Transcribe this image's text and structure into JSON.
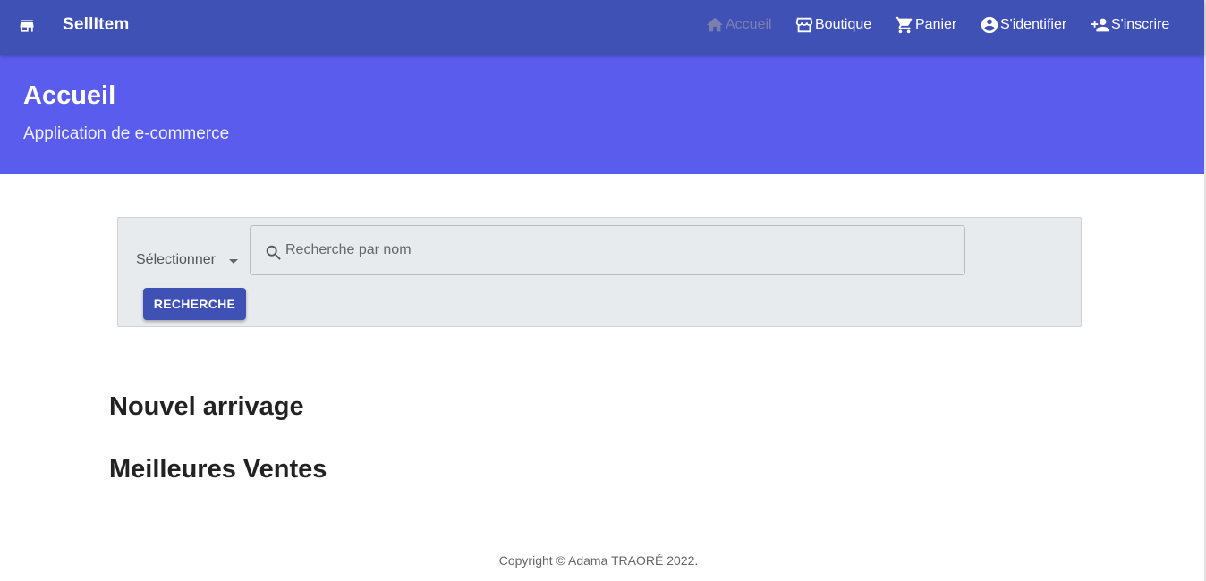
{
  "app": {
    "brand_icon": "store-icon",
    "brand_name": "SellItem"
  },
  "nav": [
    {
      "icon": "home-icon",
      "label": "Accueil",
      "active": true
    },
    {
      "icon": "storefront-icon",
      "label": "Boutique",
      "active": false
    },
    {
      "icon": "shopping-cart-icon",
      "label": "Panier",
      "active": false
    },
    {
      "icon": "account-circle-icon",
      "label": "S'identifier",
      "active": false
    },
    {
      "icon": "person-add-icon",
      "label": "S'inscrire",
      "active": false
    }
  ],
  "hero": {
    "title": "Accueil",
    "subtitle": "Application de e-commerce"
  },
  "search": {
    "select_value": "Sélectionner",
    "input_value": "",
    "input_placeholder": "Recherche par nom",
    "button_label": "RECHERCHE"
  },
  "sections": {
    "new_arrivals": "Nouvel arrivage",
    "best_sellers": "Meilleures Ventes"
  },
  "footer": {
    "copyright": "Copyright © Adama TRAORÉ 2022."
  },
  "colors": {
    "appbar": "#3f51b5",
    "hero": "#5a5ced",
    "button": "#3f51b5",
    "card": "#e8ebee"
  }
}
